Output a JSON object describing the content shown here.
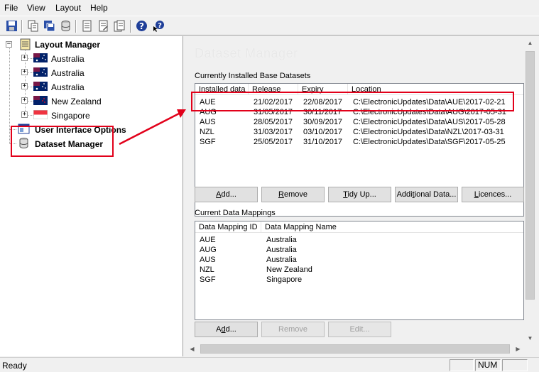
{
  "menu": {
    "file": "File",
    "view": "View",
    "layout": "Layout",
    "help": "Help"
  },
  "toolbar": {
    "icons": [
      "save-icon",
      "copy-icon",
      "save-all-icon",
      "database-icon",
      "report-icon",
      "report-edit-icon",
      "report-list-icon",
      "help-icon",
      "context-help-icon"
    ]
  },
  "tree": {
    "root": "Layout Manager",
    "layouts": [
      {
        "label": "Australia",
        "flag": "australia-flag-icon"
      },
      {
        "label": "Australia",
        "flag": "australia-flag-icon"
      },
      {
        "label": "Australia",
        "flag": "australia-flag-icon"
      },
      {
        "label": "New Zealand",
        "flag": "new-zealand-flag-icon"
      },
      {
        "label": "Singapore",
        "flag": "singapore-flag-icon"
      }
    ],
    "ui_options": "User Interface Options",
    "dataset_manager": "Dataset Manager"
  },
  "dataset_manager": {
    "title": "Dataset Manager",
    "installed_label": "Currently Installed Base Datasets",
    "installed_columns": [
      "Installed data",
      "Release",
      "Expiry",
      "Location"
    ],
    "installed_rows": [
      [
        "AUE",
        "21/02/2017",
        "22/08/2017",
        "C:\\ElectronicUpdates\\Data\\AUE\\2017-02-21"
      ],
      [
        "AUG",
        "31/05/2017",
        "30/11/2017",
        "C:\\ElectronicUpdates\\Data\\AUG\\2017-05-31"
      ],
      [
        "AUS",
        "28/05/2017",
        "30/09/2017",
        "C:\\ElectronicUpdates\\Data\\AUS\\2017-05-28"
      ],
      [
        "NZL",
        "31/03/2017",
        "03/10/2017",
        "C:\\ElectronicUpdates\\Data\\NZL\\2017-03-31"
      ],
      [
        "SGF",
        "25/05/2017",
        "31/10/2017",
        "C:\\ElectronicUpdates\\Data\\SGF\\2017-05-25"
      ]
    ],
    "buttons": {
      "add": {
        "pre": "",
        "u": "A",
        "post": "dd..."
      },
      "remove": {
        "pre": "",
        "u": "R",
        "post": "emove"
      },
      "tidy": {
        "pre": "",
        "u": "T",
        "post": "idy Up..."
      },
      "additional": {
        "pre": "Addi",
        "u": "t",
        "post": "ional Data..."
      },
      "licences": {
        "pre": "",
        "u": "L",
        "post": "icences..."
      }
    },
    "mappings_label": "Current Data Mappings",
    "mappings_columns": [
      "Data Mapping ID",
      "Data Mapping Name"
    ],
    "mappings_rows": [
      [
        "AUE",
        "Australia"
      ],
      [
        "AUG",
        "Australia"
      ],
      [
        "AUS",
        "Australia"
      ],
      [
        "NZL",
        "New Zealand"
      ],
      [
        "SGF",
        "Singapore"
      ]
    ],
    "mapping_buttons": {
      "add": {
        "pre": "A",
        "u": "d",
        "post": "d..."
      },
      "remove": "Remove",
      "edit": "Edit..."
    }
  },
  "status": {
    "text": "Ready",
    "num": "NUM"
  },
  "colors": {
    "annotation": "#e2001a",
    "accent": "#0078d7"
  }
}
